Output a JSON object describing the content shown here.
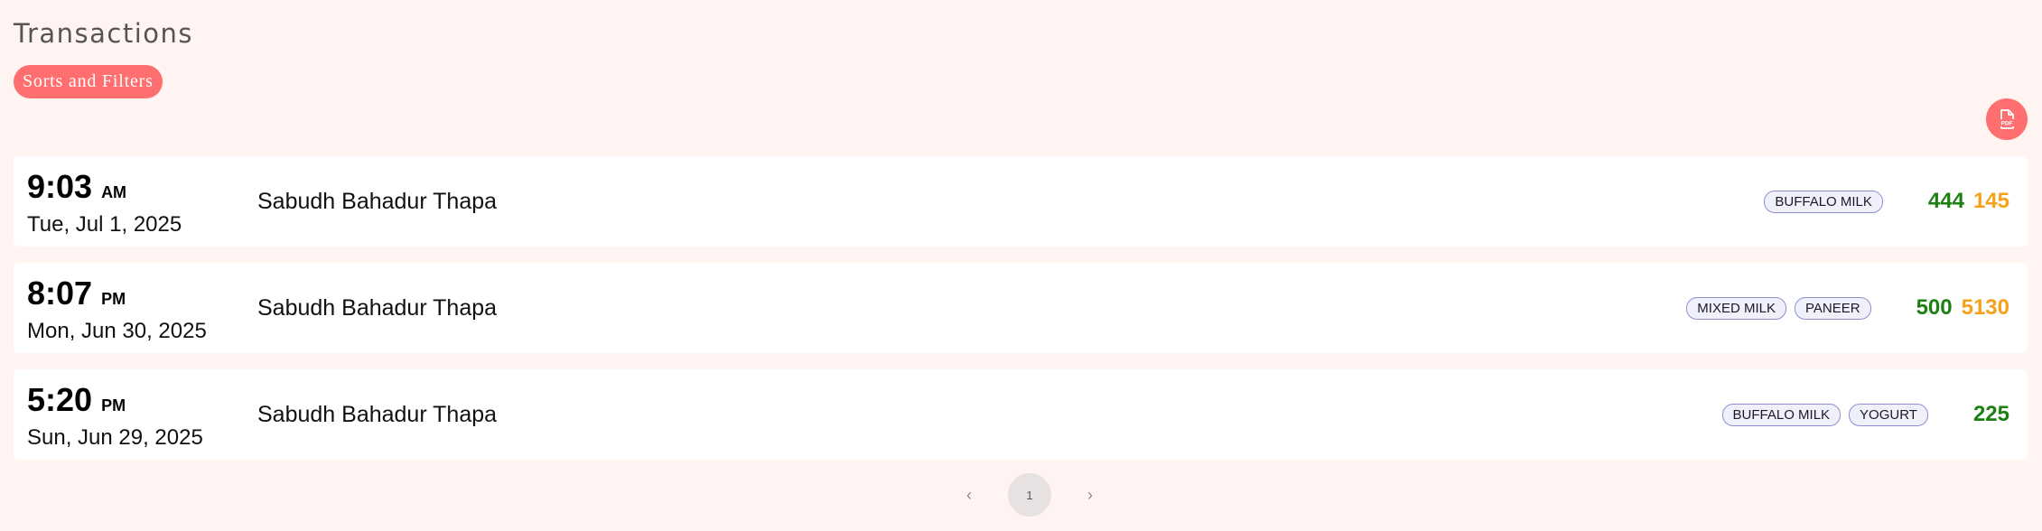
{
  "header": {
    "title": "Transactions",
    "filter_label": "Sorts and Filters",
    "pdf_label": "PDF"
  },
  "colors": {
    "accent": "#ff6f6f",
    "background": "#fff4f2",
    "amount_primary": "#1b7f12",
    "amount_secondary": "#f5a11a",
    "tag_border": "#8d8fd0"
  },
  "transactions": [
    {
      "time": "9:03",
      "ampm": "AM",
      "date": "Tue, Jul 1, 2025",
      "name": "Sabudh Bahadur Thapa",
      "tags": [
        "BUFFALO MILK"
      ],
      "amount_green": "444",
      "amount_orange": "145"
    },
    {
      "time": "8:07",
      "ampm": "PM",
      "date": "Mon, Jun 30, 2025",
      "name": "Sabudh Bahadur Thapa",
      "tags": [
        "MIXED MILK",
        "PANEER"
      ],
      "amount_green": "500",
      "amount_orange": "5130"
    },
    {
      "time": "5:20",
      "ampm": "PM",
      "date": "Sun, Jun 29, 2025",
      "name": "Sabudh Bahadur Thapa",
      "tags": [
        "BUFFALO MILK",
        "YOGURT"
      ],
      "amount_green": "225",
      "amount_orange": ""
    }
  ],
  "pagination": {
    "prev": "‹",
    "current": "1",
    "next": "›"
  }
}
